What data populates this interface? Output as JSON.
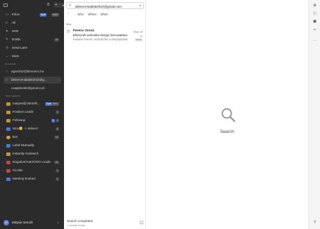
{
  "sidebar": {
    "nav": [
      {
        "label": "Inbox",
        "icon": "inbox-icon",
        "badge_split": "Split",
        "badge_total": "9467"
      },
      {
        "label": "All",
        "icon": "tray-icon"
      },
      {
        "label": "Sent",
        "icon": "sent-icon"
      },
      {
        "label": "Drafts",
        "icon": "draft-icon",
        "badge": "49"
      },
      {
        "label": "Send Later",
        "icon": "clock-icon"
      },
      {
        "label": "More",
        "icon": "chevron-down-icon"
      }
    ],
    "accounts_title": "Accounts",
    "accounts": [
      {
        "label": "agnesfaz@dinoxenc.hu"
      },
      {
        "label": "debreceniablak2022@g..."
      },
      {
        "label": "csapjekelek@gmail.com"
      }
    ],
    "labels_title": "Team spaces",
    "labels": [
      {
        "label": "matyas@clientoft...",
        "color": "#c4933a",
        "badge_split": "Split",
        "badge_total": "3467"
      },
      {
        "label": "Positive Leads",
        "color": "#c4933a",
        "badge": "3"
      },
      {
        "label": "Followup",
        "color": "#c4933a",
        "badge_blue": "1",
        "badge": "4"
      },
      {
        "label": "Won😊 -> deliver!",
        "color": "#4a7bd1",
        "badge": "5"
      },
      {
        "label": "Bot",
        "color": "#d4a037",
        "badge": "14"
      },
      {
        "label": "Label Manually",
        "color": "#4a7bd1"
      },
      {
        "label": "Instantly Outreach",
        "color": "#c4933a"
      },
      {
        "label": "Negative/Auto/OOO Leads",
        "color": "#b84a4a",
        "badge": "44"
      },
      {
        "label": "GLABs",
        "color": "#b84a4a",
        "badge": "1"
      },
      {
        "label": "Meeting booked",
        "color": "#4a7bd1",
        "badge": "2"
      }
    ],
    "user": {
      "name": "Mátyás Saruzli",
      "initials": "M"
    }
  },
  "search": {
    "query": "debreceniablak2022@gmail.com",
    "filters": [
      "Who",
      "Where",
      "When"
    ]
  },
  "results": {
    "group_label": "May",
    "emails": [
      {
        "from": "Ferenc Orosz",
        "date": "May 18",
        "subject": "Elkészült weboldal design bemutatása",
        "snippet": "Kedves Ferenc, Köszönöm a visszajelzést",
        "tag": "Inbox"
      }
    ],
    "status": "Search completed",
    "count": "1 results found"
  },
  "main": {
    "empty_title": "Search"
  },
  "rail": {
    "icons": [
      "add-circle-icon",
      "info-icon",
      "calendar-icon",
      "plus-icon",
      "more-icon",
      "help-icon"
    ]
  },
  "colors": {
    "sidebar_bg": "#2b2b2b",
    "accent_blue": "#3f6fd6"
  }
}
